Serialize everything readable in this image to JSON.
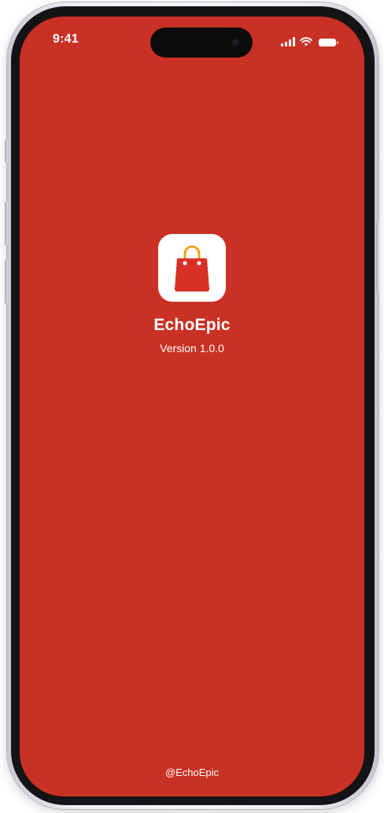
{
  "status_bar": {
    "time": "9:41",
    "icons": [
      "cellular-signal-icon",
      "wifi-icon",
      "battery-icon"
    ]
  },
  "splash": {
    "icon": "shopping-bag-icon",
    "app_name": "EchoEpic",
    "version": "Version 1.0.0"
  },
  "footer": {
    "handle": "@EchoEpic"
  },
  "colors": {
    "background": "#c93124",
    "bag": "#d93025",
    "bag_handle": "#f0a21e",
    "text": "#ffffff"
  }
}
